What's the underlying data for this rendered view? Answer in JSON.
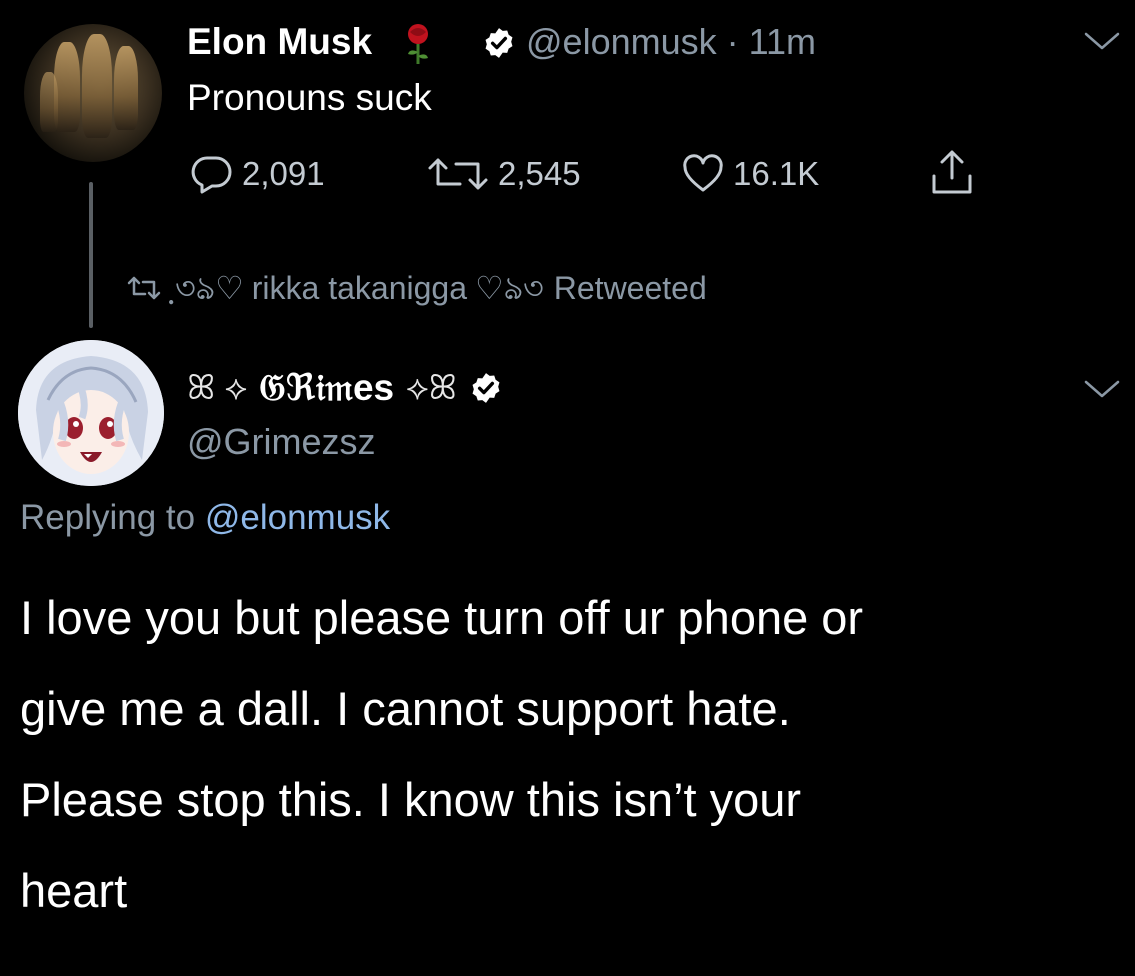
{
  "tweet1": {
    "author": "Elon Musk",
    "handle": "@elonmusk",
    "separator": "·",
    "time": "11m",
    "text": "Pronouns suck",
    "actions": {
      "replies": "2,091",
      "retweets": "2,545",
      "likes": "16.1K"
    },
    "icons": [
      "rose-emoji-icon",
      "verified-badge-icon",
      "chevron-down-icon",
      "reply-icon",
      "retweet-icon",
      "like-icon",
      "share-icon"
    ]
  },
  "retweet_banner": {
    "deco_left": "ฺ৩ঌ♡",
    "user": "rikka takanigga",
    "deco_right": "♡ঌ৩",
    "label": "Retweeted"
  },
  "tweet2": {
    "orn_left": "ꕤ ⟡",
    "author": "Grimes",
    "author_display": "𝔊ℜ𝔦𝔪es",
    "orn_right": "⟡ꕤ",
    "handle": "@Grimezsz",
    "replying_prefix": "Replying to",
    "replying_handle": "@elonmusk",
    "text_lines": [
      "I love you but please turn off ur phone or",
      "give me a dall.  I cannot support hate.",
      "Please stop this. I know this isn’t your",
      "heart"
    ]
  },
  "colors": {
    "background": "#000000",
    "text": "#ffffff",
    "muted": "#8b98a5",
    "link": "#8fb8e8",
    "rose": "#c0121e",
    "thread_line": "#5a5f64"
  }
}
